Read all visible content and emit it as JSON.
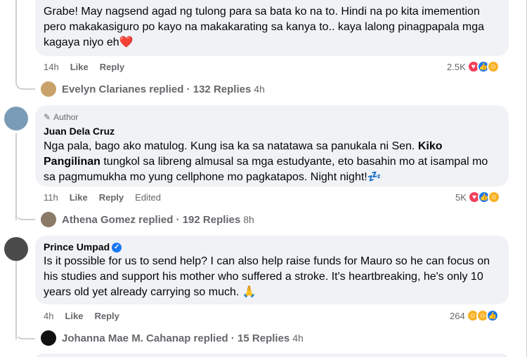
{
  "comment1": {
    "text": "Grabe! May nagsend agad ng tulong para sa bata ko na to. Hindi na po kita imemention pero makakasiguro po kayo na makakarating sa kanya to.. kaya lalong pinagpapala mga kagaya niyo eh",
    "emoji": "❤️",
    "time": "14h",
    "like": "Like",
    "reply": "Reply",
    "reaction_count": "2.5K"
  },
  "replies1": {
    "text": "Evelyn Clarianes replied · 132 Replies",
    "time": "4h"
  },
  "comment2": {
    "badge": "Author",
    "name": "Juan Dela Cruz",
    "text_a": "Nga pala, bago ako matulog. Kung isa ka sa natatawa sa panukala ni Sen. ",
    "text_bold": "Kiko Pangilinan",
    "text_b": " tungkol sa libreng almusal sa mga estudyante, eto basahin mo at isampal mo sa pagmumukha mo yung cellphone mo pagkatapos. Night night!",
    "emoji": "💤",
    "time": "11h",
    "like": "Like",
    "reply": "Reply",
    "edited": "Edited",
    "reaction_count": "5K"
  },
  "replies2": {
    "text": "Athena Gomez replied · 192 Replies",
    "time": "8h"
  },
  "comment3": {
    "name": "Prince Umpad",
    "text": "Is it possible for us to send help? I can also help raise funds for Mauro so he can focus on his studies and support his mother who suffered a stroke. It's heartbreaking, he's only 10 years old yet already carrying so much.",
    "emoji": "🙏",
    "time": "4h",
    "like": "Like",
    "reply": "Reply",
    "reaction_count": "264"
  },
  "replies3": {
    "text": "Johanna Mae M. Cahanap replied · 15 Replies",
    "time": "4h"
  },
  "icons": {
    "heart": "heart-icon",
    "like": "like-icon",
    "care": "care-icon",
    "haha": "haha-icon",
    "verified": "verified-badge-icon",
    "pencil": "pencil-icon"
  },
  "colors": {
    "accent": "#1877f2",
    "bubble": "#f0f2f5",
    "meta": "#65676b"
  }
}
